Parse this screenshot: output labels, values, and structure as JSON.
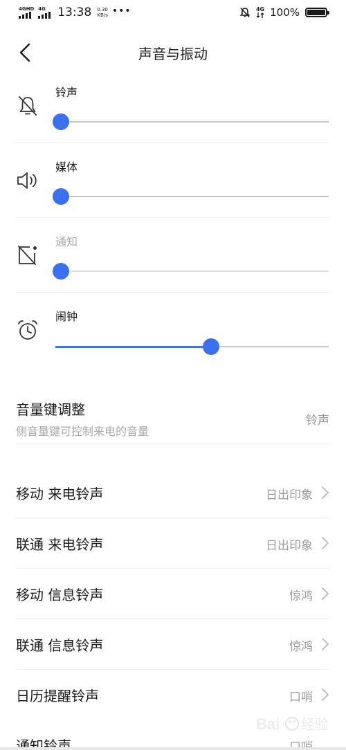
{
  "status": {
    "net1": "4GHD",
    "net2": "4G",
    "time": "13:38",
    "speed_value": "0.30",
    "speed_unit": "KB/s",
    "dots": "•••",
    "net3": "4G",
    "battery_text": "100%",
    "battery_level": 1.0
  },
  "header": {
    "title": "声音与振动"
  },
  "volumes": [
    {
      "label": "铃声",
      "icon": "bell-off-icon",
      "level": 0.02,
      "dim": false
    },
    {
      "label": "媒体",
      "icon": "speaker-icon",
      "level": 0.02,
      "dim": false
    },
    {
      "label": "通知",
      "icon": "notification-off-icon",
      "level": 0.02,
      "dim": true
    },
    {
      "label": "闹钟",
      "icon": "alarm-clock-icon",
      "level": 0.57,
      "dim": false
    }
  ],
  "volume_key": {
    "title": "音量键调整",
    "subtitle": "侧音量键可控制来电的音量",
    "value": "铃声"
  },
  "items": [
    {
      "title": "移动 来电铃声",
      "value": "日出印象"
    },
    {
      "title": "联通 来电铃声",
      "value": "日出印象"
    },
    {
      "title": "移动 信息铃声",
      "value": "惊鸿"
    },
    {
      "title": "联通 信息铃声",
      "value": "惊鸿"
    },
    {
      "title": "日历提醒铃声",
      "value": "口哨"
    },
    {
      "title": "通知铃声",
      "value": "口哨"
    }
  ],
  "colors": {
    "accent": "#3a6ff0",
    "track": "#c4c4c4"
  }
}
